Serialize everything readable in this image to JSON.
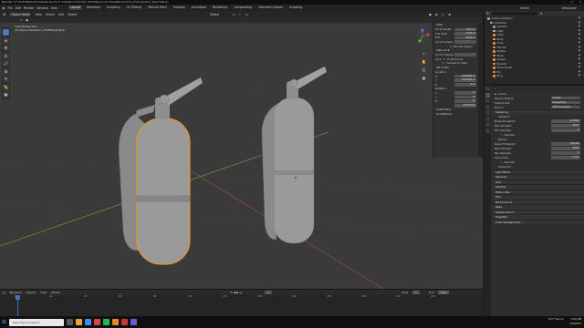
{
  "window": {
    "title": "Blender* [F:\\TUTORIALS\\Complete Guide to Substance Painter 2023\\Resource Files\\Blender\\Fire_Extinguisher_Start.blend]"
  },
  "menu": [
    "File",
    "Edit",
    "Render",
    "Window",
    "Help"
  ],
  "workspaces": [
    "Layout",
    "Modeling",
    "Sculpting",
    "UV Editing",
    "Texture Paint",
    "Shading",
    "Animation",
    "Rendering",
    "Compositing",
    "Geometry Nodes",
    "Scripting"
  ],
  "active_workspace": "Layout",
  "viewport": {
    "mode": "Object Mode",
    "menus": [
      "View",
      "Select",
      "Add",
      "Object"
    ],
    "overlay_line1": "User Perspective",
    "overlay_line2": "(1) Scene Collection | FireExtinguisher",
    "transform_orientation": "Global"
  },
  "npanel": {
    "view_header": "View",
    "focal_length_label": "Focal Length",
    "focal_length": "50 mm",
    "clip_start_label": "Clip Start",
    "clip_start": "0.01 m",
    "end_label": "End",
    "clip_end": "1000 m",
    "local_camera_label": "Local Camera",
    "render_region_label": "Render Region",
    "view_lock_header": "View Lock",
    "lock_to_object_label": "Lock to Object",
    "lock_label": "Lock",
    "to_3d_cursor_label": "To 3D Cursor",
    "camera_to_view_label": "Camera to View",
    "cursor_header": "3D Cursor",
    "location_label": "Location:",
    "cursor_x": "0.00669 m",
    "cursor_y": "0.02093 m",
    "cursor_z": "0 m",
    "rotation_label": "Rotation:",
    "rot_x": "0°",
    "rot_y": "0°",
    "rot_z": "0°",
    "rotation_mode": "XYZ Euler",
    "collections_header": "Collections",
    "annotations_header": "Annotations"
  },
  "timeline": {
    "menus": [
      "Playback",
      "Keying",
      "View",
      "Marker"
    ],
    "current_frame": "1",
    "start_label": "Start",
    "start": "1",
    "end_label": "End",
    "end": "250",
    "ticks": [
      "0",
      "20",
      "40",
      "60",
      "80",
      "100",
      "120",
      "140",
      "160",
      "180",
      "200",
      "220",
      "240"
    ]
  },
  "topright": {
    "scene_label": "Scene",
    "view_layer_label": "ViewLayer"
  },
  "outliner": {
    "search_placeholder": "",
    "items": [
      {
        "label": "Scene Collection",
        "color": "#9a9a9a"
      },
      {
        "label": "Collection",
        "color": "#9a9a9a"
      },
      {
        "label": "Camera",
        "color": "#7a93c9"
      },
      {
        "label": "Light",
        "color": "#c9b77a"
      },
      {
        "label": "Cube",
        "color": "#e08a3a"
      },
      {
        "label": "Body",
        "color": "#e08a3a"
      },
      {
        "label": "Hose",
        "color": "#e08a3a"
      },
      {
        "label": "Handle",
        "color": "#e08a3a"
      },
      {
        "label": "Nozzle",
        "color": "#e08a3a"
      },
      {
        "label": "Strap",
        "color": "#e08a3a"
      },
      {
        "label": "Gauge",
        "color": "#e08a3a"
      },
      {
        "label": "Bracket",
        "color": "#e08a3a"
      },
      {
        "label": "Hose Holder",
        "color": "#e08a3a"
      },
      {
        "label": "Pin",
        "color": "#e08a3a"
      },
      {
        "label": "Ring",
        "color": "#e08a3a"
      }
    ]
  },
  "properties": {
    "scene_name": "Scene",
    "render_engine_label": "Render Engine",
    "render_engine": "Cycles",
    "feature_set_label": "Feature Set",
    "feature_set": "Supported",
    "device_label": "Device",
    "device": "GPU Compute",
    "sampling_header": "Sampling",
    "viewport_header": "Viewport",
    "noise_threshold_label": "Noise Threshold",
    "vp_noise_threshold": "0.1000",
    "max_samples_label": "Max Samples",
    "vp_max_samples": "1024",
    "min_samples_label": "Min Samples",
    "vp_min_samples": "0",
    "denoise_label": "Denoise",
    "render_header": "Render",
    "r_noise_threshold": "0.0100",
    "r_max_samples": "4096",
    "r_min_samples": "0",
    "time_limit_label": "Time Limit",
    "r_time_limit": "0 sec",
    "advanced_label": "Advanced",
    "panels": [
      "Light Paths",
      "Volumes",
      "Hair",
      "Simplify",
      "Motion Blur",
      "Film",
      "Performance",
      "Bake",
      "Grease Pencil",
      "Freestyle",
      "Color Management"
    ]
  },
  "taskbar": {
    "search_placeholder": "Type here to search",
    "weather": "81°F Sunny",
    "time": "4:05 PM",
    "date": "5/9/2023"
  },
  "colors": {
    "selection_outline": "#e8942c",
    "accent_blue": "#4772b3",
    "viewport_bg": "#3a3a3a"
  }
}
